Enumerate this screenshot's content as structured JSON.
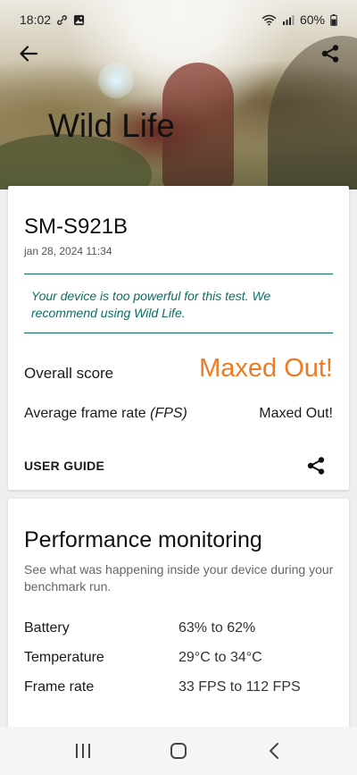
{
  "status_bar": {
    "time": "18:02",
    "battery": "60%"
  },
  "hero": {
    "title": "Wild Life"
  },
  "result": {
    "device": "SM-S921B",
    "timestamp": "jan 28, 2024 11:34",
    "notice": "Your device is too powerful for this test. We recommend using Wild Life.",
    "overall_score_label": "Overall score",
    "overall_score_value": "Maxed Out!",
    "fps_label_prefix": "Average frame rate ",
    "fps_label_unit": "(FPS)",
    "fps_value": "Maxed Out!",
    "user_guide_label": "USER GUIDE"
  },
  "performance": {
    "title": "Performance monitoring",
    "description": "See what was happening inside your device during your benchmark run.",
    "rows": [
      {
        "label": "Battery",
        "value": "63% to 62%"
      },
      {
        "label": "Temperature",
        "value": "29°C to 34°C"
      },
      {
        "label": "Frame rate",
        "value": "33 FPS to 112 FPS"
      }
    ]
  },
  "colors": {
    "accent_orange": "#ee7b22",
    "notice_teal": "#0e6e63"
  },
  "icons": [
    "link-icon",
    "image-icon",
    "wifi-icon",
    "signal-icon",
    "battery-icon",
    "back-arrow-icon",
    "share-icon",
    "recents-icon",
    "home-icon",
    "back-icon"
  ]
}
